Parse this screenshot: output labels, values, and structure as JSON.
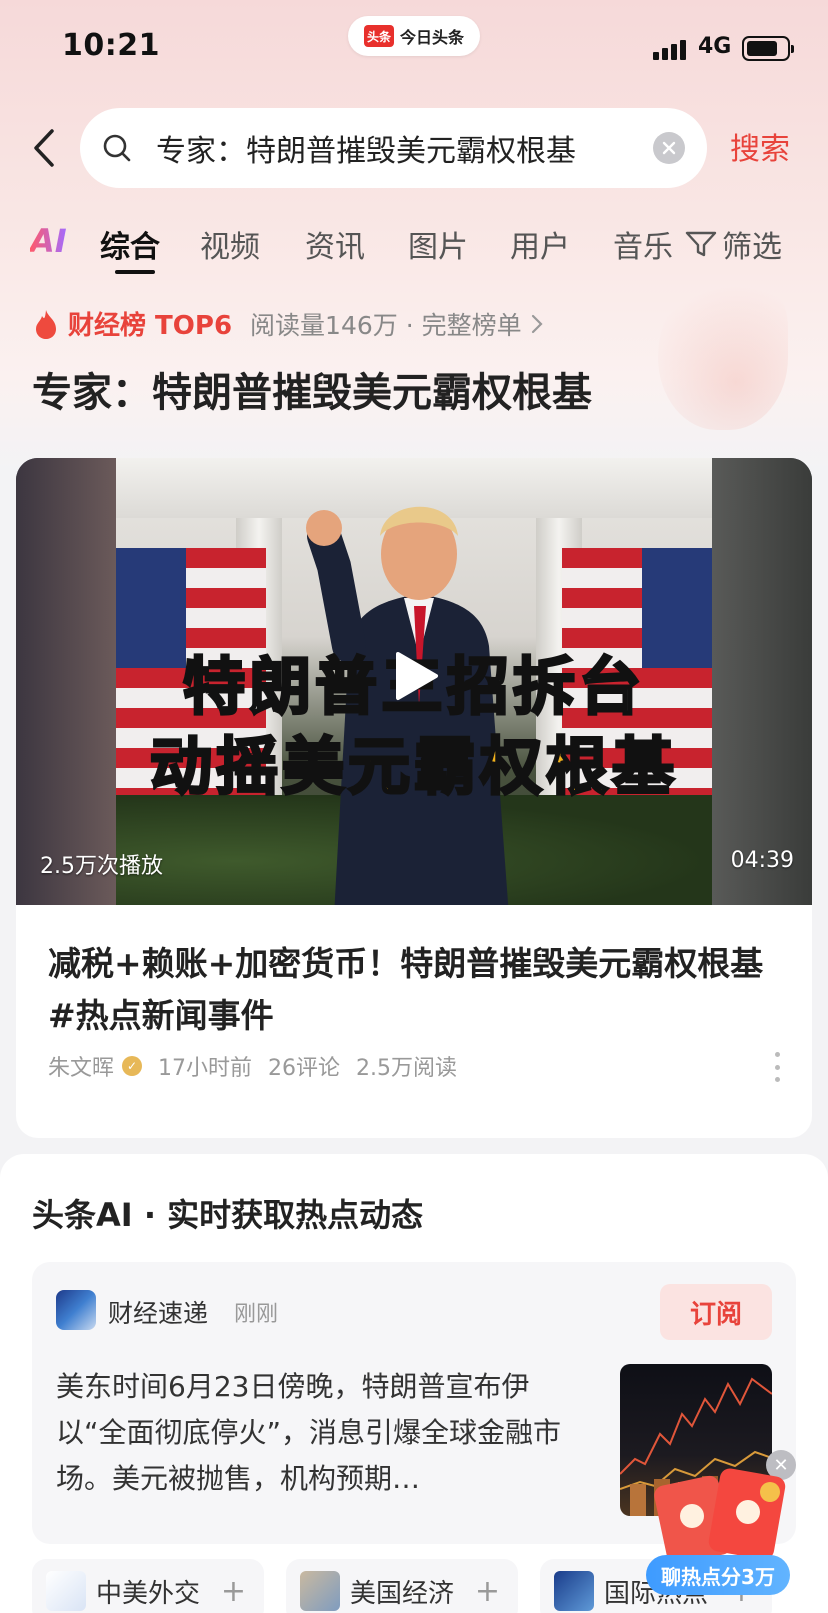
{
  "status_bar": {
    "time": "10:21",
    "app_name": "今日头条",
    "app_logo_text": "头条",
    "network": "4G",
    "battery_percent": 80
  },
  "search": {
    "query": "专家：特朗普摧毁美元霸权根基",
    "submit_label": "搜索"
  },
  "tabs": {
    "ai_label": "AI",
    "items": [
      "综合",
      "视频",
      "资讯",
      "图片",
      "用户",
      "音乐"
    ],
    "active": "综合",
    "filter_label": "筛选"
  },
  "hot": {
    "badge": "财经榜 TOP6",
    "meta": "阅读量146万 · 完整榜单",
    "title": "专家：特朗普摧毁美元霸权根基"
  },
  "video": {
    "overlay_line1": "特朗普三招拆台",
    "overlay_line2": "动摇美元霸权根基",
    "plays": "2.5万次播放",
    "duration": "04:39",
    "title": "减税+赖账+加密货币！特朗普摧毁美元霸权根基 #热点新闻事件",
    "author": "朱文晖",
    "time": "17小时前",
    "comments": "26评论",
    "reads": "2.5万阅读"
  },
  "ai_section": {
    "heading": "头条AI · 实时获取热点动态",
    "source_name": "财经速递",
    "source_time": "刚刚",
    "subscribe_label": "订阅",
    "summary": "美东时间6月23日傍晚，特朗普宣布伊以“全面彻底停火”，消息引爆全球金融市场。美元被抛售，机构预期…"
  },
  "chips": [
    {
      "label": "中美外交"
    },
    {
      "label": "美国经济"
    },
    {
      "label": "国际热点"
    }
  ],
  "float_widget": {
    "label": "聊热点分3万"
  }
}
